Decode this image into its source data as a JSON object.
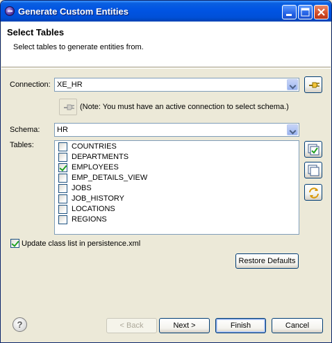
{
  "window": {
    "title": "Generate Custom Entities",
    "controls": [
      "minimize-icon",
      "maximize-icon",
      "close-icon"
    ]
  },
  "header": {
    "title": "Select Tables",
    "description": "Select tables to generate entities from."
  },
  "connection": {
    "label": "Connection:",
    "value": "XE_HR",
    "note": "(Note: You must have an active connection to select schema.)"
  },
  "schema": {
    "label": "Schema:",
    "value": "HR"
  },
  "tables": {
    "label": "Tables:",
    "items": [
      {
        "name": "COUNTRIES",
        "checked": false
      },
      {
        "name": "DEPARTMENTS",
        "checked": false
      },
      {
        "name": "EMPLOYEES",
        "checked": true
      },
      {
        "name": "EMP_DETAILS_VIEW",
        "checked": false
      },
      {
        "name": "JOBS",
        "checked": false
      },
      {
        "name": "JOB_HISTORY",
        "checked": false
      },
      {
        "name": "LOCATIONS",
        "checked": false
      },
      {
        "name": "REGIONS",
        "checked": false
      }
    ]
  },
  "update_class_list": {
    "label": "Update class list in persistence.xml",
    "checked": true
  },
  "buttons": {
    "restore_defaults": "Restore Defaults",
    "back": "< Back",
    "next": "Next >",
    "finish": "Finish",
    "cancel": "Cancel",
    "help": "?"
  }
}
